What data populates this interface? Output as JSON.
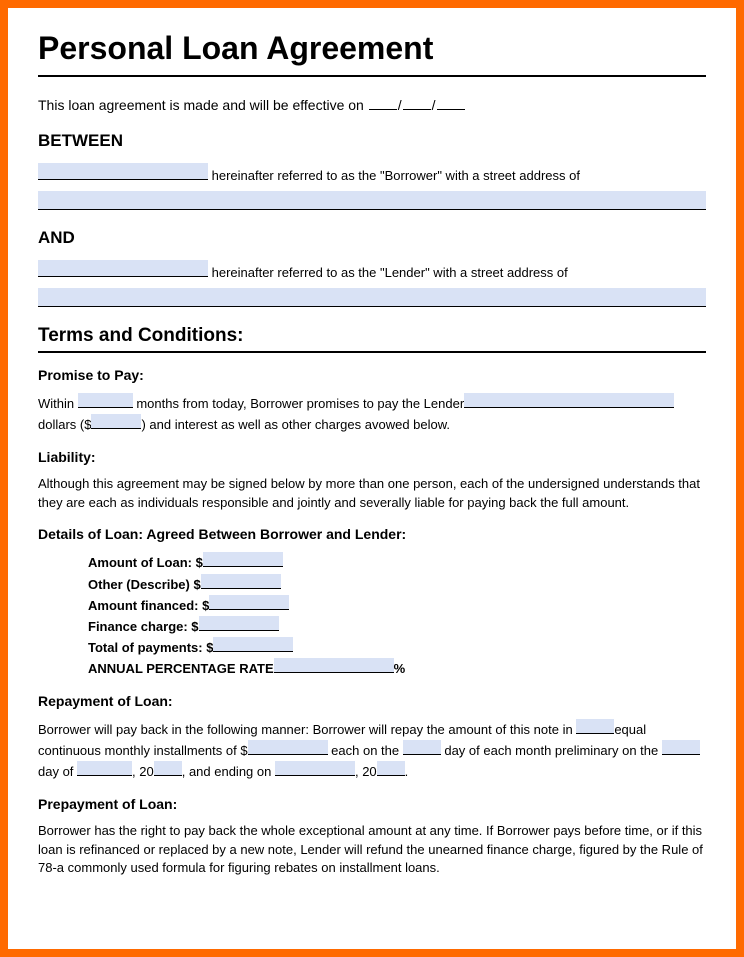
{
  "title": "Personal Loan Agreement",
  "intro": "This loan agreement is made and will be effective on",
  "between": "BETWEEN",
  "borrower_text": " hereinafter referred to as the \"Borrower\" with a street address of",
  "and": "AND",
  "lender_text": " hereinafter referred to as the \"Lender\" with a street address of",
  "terms_head": "Terms and Conditions:",
  "promise_head": "Promise to Pay:",
  "promise_a": "Within ",
  "promise_b": " months from today, Borrower promises to pay the Lender",
  "promise_c": " dollars ($",
  "promise_d": ") and interest as well as other charges avowed below.",
  "liability_head": "Liability:",
  "liability_text": "Although this agreement may be signed below by more than one person, each of the undersigned understands that they are each as individuals responsible and jointly and severally liable for paying back the full amount.",
  "details_head": "Details of Loan: Agreed Between Borrower and Lender:",
  "details": {
    "amount": "Amount of Loan: $",
    "other": "Other (Describe) $",
    "financed": "Amount financed: $",
    "finance_charge": "Finance charge: $",
    "total": "Total of payments: $",
    "apr": "ANNUAL PERCENTAGE RATE",
    "percent": "%"
  },
  "repay_head": "Repayment of Loan:",
  "repay_a": "Borrower will pay back in the following manner: Borrower will repay the amount of this note in ",
  "repay_b": "equal continuous monthly installments of $",
  "repay_c": " each on the ",
  "repay_d": " day of each month preliminary on the ",
  "repay_e": "day of ",
  "repay_f": ", 20",
  "repay_g": ", and ending on ",
  "repay_h": ", 20",
  "repay_i": ".",
  "prepay_head": "Prepayment of Loan:",
  "prepay_text": "Borrower has the right to pay back the whole exceptional amount at any time. If Borrower pays before time, or if this loan is refinanced or replaced by a new note, Lender will refund the unearned finance charge, figured by the Rule of 78-a commonly used formula for figuring rebates on installment loans."
}
